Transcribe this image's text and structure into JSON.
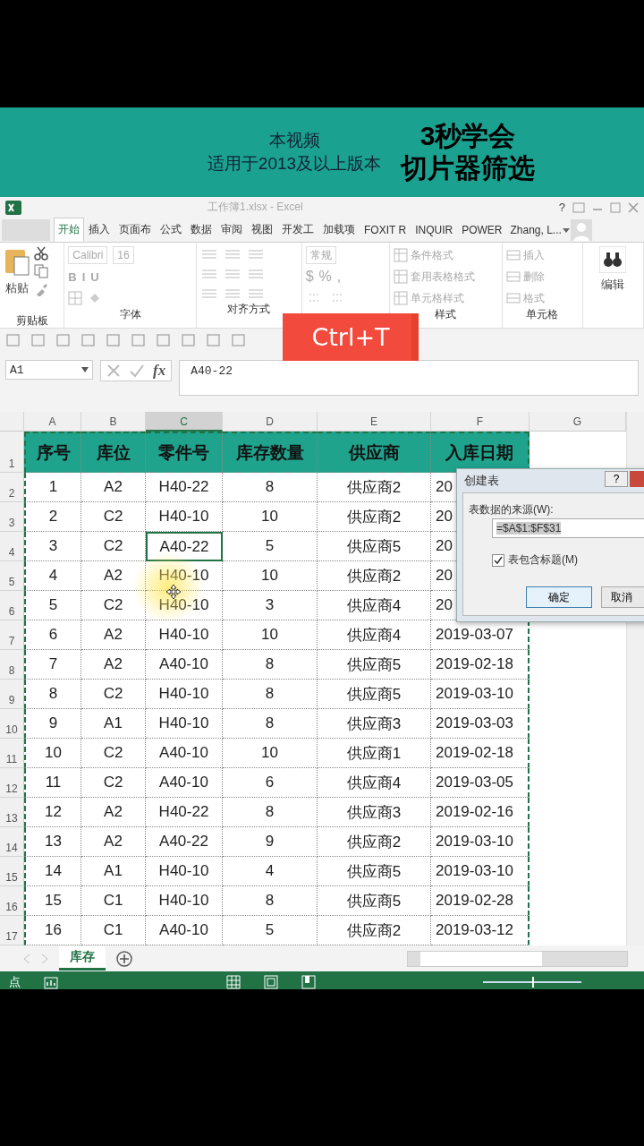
{
  "banner": {
    "subtitle_lines": [
      "本视频",
      "适用于2013及以上版本"
    ],
    "headline_lines": [
      "3秒学会",
      "切片器筛选"
    ]
  },
  "window": {
    "title": "工作簿1.xlsx - Excel",
    "help": "?"
  },
  "ribbon_tabs": [
    {
      "label": "开始",
      "selected": true
    },
    {
      "label": "插入",
      "selected": false
    },
    {
      "label": "页面布",
      "selected": false
    },
    {
      "label": "公式",
      "selected": false
    },
    {
      "label": "数据",
      "selected": false
    },
    {
      "label": "审阅",
      "selected": false
    },
    {
      "label": "视图",
      "selected": false
    },
    {
      "label": "开发工",
      "selected": false
    },
    {
      "label": "加载项",
      "selected": false
    },
    {
      "label": "FOXIT R",
      "selected": false
    },
    {
      "label": "INQUIR",
      "selected": false
    },
    {
      "label": "POWER",
      "selected": false
    }
  ],
  "user": "Zhang, L...",
  "ribbon": {
    "paste": "粘贴",
    "clipboard_label": "剪贴板",
    "font": "Calibri",
    "font_size": "16",
    "bold": "B",
    "italic": "I",
    "underline": "U",
    "font_label": "字体",
    "alignment_label": "对齐方式",
    "number_format": "常规",
    "currency": "$",
    "percent": "%",
    "comma": ",",
    "styles": [
      "条件格式",
      "套用表格格式",
      "单元格样式"
    ],
    "styles_label": "样式",
    "cells": [
      "插入",
      "删除",
      "格式"
    ],
    "cells_label": "单元格",
    "editing": "编辑"
  },
  "shortcut_overlay": "Ctrl+T",
  "formula_bar": {
    "name_box": "A1",
    "fx": "fx",
    "formula": "A40-22"
  },
  "table": {
    "columns": [
      {
        "label": "A",
        "selected": false
      },
      {
        "label": "B",
        "selected": false
      },
      {
        "label": "C",
        "selected": true
      },
      {
        "label": "D",
        "selected": false
      },
      {
        "label": "E",
        "selected": false
      },
      {
        "label": "F",
        "selected": false
      },
      {
        "label": "G",
        "selected": false
      }
    ],
    "header": {
      "number": "1",
      "cells": [
        "序号",
        "库位",
        "零件号",
        "库存数量",
        "供应商",
        "入库日期"
      ]
    },
    "rows": [
      {
        "number": "2",
        "cells": [
          {
            "text": "1",
            "selected": false
          },
          {
            "text": "A2",
            "selected": false
          },
          {
            "text": "H40-22",
            "selected": false
          },
          {
            "text": "8",
            "selected": false
          },
          {
            "text": "供应商2",
            "selected": false
          },
          {
            "text": "20",
            "selected": false
          }
        ]
      },
      {
        "number": "3",
        "cells": [
          {
            "text": "2",
            "selected": false
          },
          {
            "text": "C2",
            "selected": false
          },
          {
            "text": "H40-10",
            "selected": false
          },
          {
            "text": "10",
            "selected": false
          },
          {
            "text": "供应商2",
            "selected": false
          },
          {
            "text": "20",
            "selected": false
          }
        ]
      },
      {
        "number": "4",
        "cells": [
          {
            "text": "3",
            "selected": false
          },
          {
            "text": "C2",
            "selected": false
          },
          {
            "text": "A40-22",
            "selected": true
          },
          {
            "text": "5",
            "selected": false
          },
          {
            "text": "供应商5",
            "selected": false
          },
          {
            "text": "20",
            "selected": false
          }
        ]
      },
      {
        "number": "5",
        "cells": [
          {
            "text": "4",
            "selected": false
          },
          {
            "text": "A2",
            "selected": false
          },
          {
            "text": "H40-10",
            "selected": false
          },
          {
            "text": "10",
            "selected": false
          },
          {
            "text": "供应商2",
            "selected": false
          },
          {
            "text": "20",
            "selected": false
          }
        ]
      },
      {
        "number": "6",
        "cells": [
          {
            "text": "5",
            "selected": false
          },
          {
            "text": "C2",
            "selected": false
          },
          {
            "text": "H40-10",
            "selected": false
          },
          {
            "text": "3",
            "selected": false
          },
          {
            "text": "供应商4",
            "selected": false
          },
          {
            "text": "20",
            "selected": false
          }
        ]
      },
      {
        "number": "7",
        "cells": [
          {
            "text": "6",
            "selected": false
          },
          {
            "text": "A2",
            "selected": false
          },
          {
            "text": "H40-10",
            "selected": false
          },
          {
            "text": "10",
            "selected": false
          },
          {
            "text": "供应商4",
            "selected": false
          },
          {
            "text": "2019-03-07",
            "selected": false
          }
        ]
      },
      {
        "number": "8",
        "cells": [
          {
            "text": "7",
            "selected": false
          },
          {
            "text": "A2",
            "selected": false
          },
          {
            "text": "A40-10",
            "selected": false
          },
          {
            "text": "8",
            "selected": false
          },
          {
            "text": "供应商5",
            "selected": false
          },
          {
            "text": "2019-02-18",
            "selected": false
          }
        ]
      },
      {
        "number": "9",
        "cells": [
          {
            "text": "8",
            "selected": false
          },
          {
            "text": "C2",
            "selected": false
          },
          {
            "text": "H40-10",
            "selected": false
          },
          {
            "text": "8",
            "selected": false
          },
          {
            "text": "供应商5",
            "selected": false
          },
          {
            "text": "2019-03-10",
            "selected": false
          }
        ]
      },
      {
        "number": "10",
        "cells": [
          {
            "text": "9",
            "selected": false
          },
          {
            "text": "A1",
            "selected": false
          },
          {
            "text": "H40-10",
            "selected": false
          },
          {
            "text": "8",
            "selected": false
          },
          {
            "text": "供应商3",
            "selected": false
          },
          {
            "text": "2019-03-03",
            "selected": false
          }
        ]
      },
      {
        "number": "11",
        "cells": [
          {
            "text": "10",
            "selected": false
          },
          {
            "text": "C2",
            "selected": false
          },
          {
            "text": "A40-10",
            "selected": false
          },
          {
            "text": "10",
            "selected": false
          },
          {
            "text": "供应商1",
            "selected": false
          },
          {
            "text": "2019-02-18",
            "selected": false
          }
        ]
      },
      {
        "number": "12",
        "cells": [
          {
            "text": "11",
            "selected": false
          },
          {
            "text": "C2",
            "selected": false
          },
          {
            "text": "A40-10",
            "selected": false
          },
          {
            "text": "6",
            "selected": false
          },
          {
            "text": "供应商4",
            "selected": false
          },
          {
            "text": "2019-03-05",
            "selected": false
          }
        ]
      },
      {
        "number": "13",
        "cells": [
          {
            "text": "12",
            "selected": false
          },
          {
            "text": "A2",
            "selected": false
          },
          {
            "text": "H40-22",
            "selected": false
          },
          {
            "text": "8",
            "selected": false
          },
          {
            "text": "供应商3",
            "selected": false
          },
          {
            "text": "2019-02-16",
            "selected": false
          }
        ]
      },
      {
        "number": "14",
        "cells": [
          {
            "text": "13",
            "selected": false
          },
          {
            "text": "A2",
            "selected": false
          },
          {
            "text": "A40-22",
            "selected": false
          },
          {
            "text": "9",
            "selected": false
          },
          {
            "text": "供应商2",
            "selected": false
          },
          {
            "text": "2019-03-10",
            "selected": false
          }
        ]
      },
      {
        "number": "15",
        "cells": [
          {
            "text": "14",
            "selected": false
          },
          {
            "text": "A1",
            "selected": false
          },
          {
            "text": "H40-10",
            "selected": false
          },
          {
            "text": "4",
            "selected": false
          },
          {
            "text": "供应商5",
            "selected": false
          },
          {
            "text": "2019-03-10",
            "selected": false
          }
        ]
      },
      {
        "number": "16",
        "cells": [
          {
            "text": "15",
            "selected": false
          },
          {
            "text": "C1",
            "selected": false
          },
          {
            "text": "H40-10",
            "selected": false
          },
          {
            "text": "8",
            "selected": false
          },
          {
            "text": "供应商5",
            "selected": false
          },
          {
            "text": "2019-02-28",
            "selected": false
          }
        ]
      },
      {
        "number": "17",
        "cells": [
          {
            "text": "16",
            "selected": false
          },
          {
            "text": "C1",
            "selected": false
          },
          {
            "text": "A40-10",
            "selected": false
          },
          {
            "text": "5",
            "selected": false
          },
          {
            "text": "供应商2",
            "selected": false
          },
          {
            "text": "2019-03-12",
            "selected": false
          }
        ]
      }
    ]
  },
  "dialog": {
    "title": "创建表",
    "help": "?",
    "source_label": "表数据的来源(W):",
    "source_value": "=$A$1:$F$31",
    "has_headers": {
      "label": "表包含标题(M)",
      "checked": true
    },
    "buttons": [
      "确定",
      "取消"
    ]
  },
  "sheet_tabs": [
    {
      "label": "库存",
      "selected": true
    }
  ],
  "status_bar": {
    "mode": "点",
    "zoom": {
      "level": 0.5
    }
  }
}
